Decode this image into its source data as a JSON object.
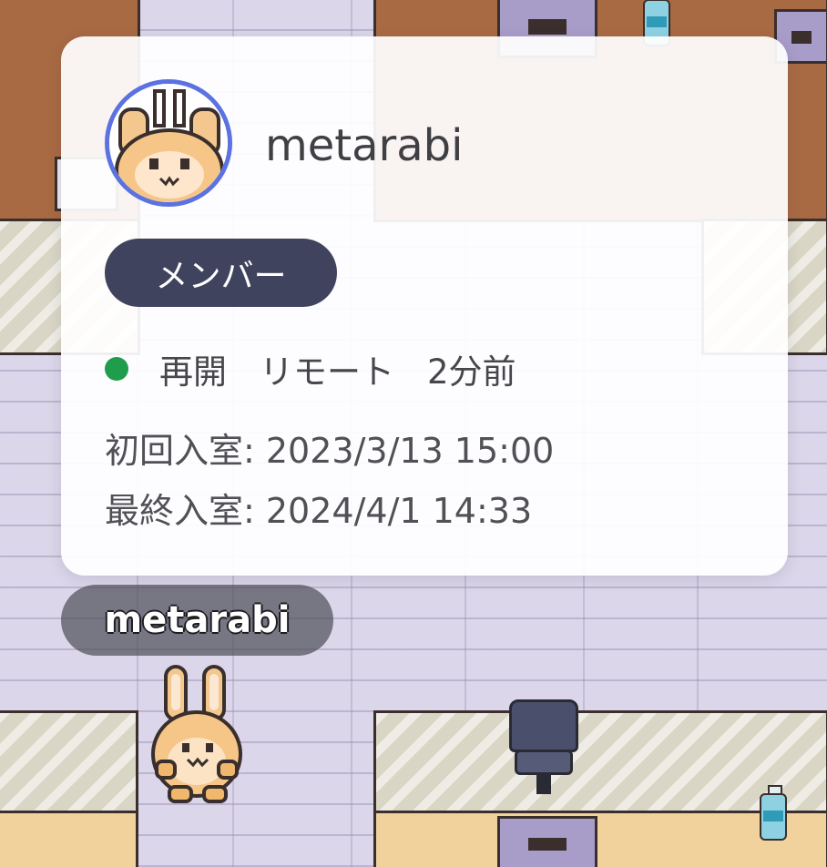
{
  "profile_card": {
    "username": "metarabi",
    "role_badge": "メンバー",
    "status": {
      "indicator_color": "#1f9d4c",
      "activity": "再開",
      "location": "リモート",
      "elapsed": "2分前"
    },
    "first_entry_label": "初回入室: 2023/3/13 15:00",
    "last_entry_label": "最終入室: 2024/4/1 14:33",
    "avatar_icon": "bunny-avatar-icon",
    "avatar_ring_color": "#5b72e0"
  },
  "player": {
    "nameplate": "metarabi",
    "sprite_icon": "bunny-sprite-icon"
  },
  "colors": {
    "badge_background": "#40435d",
    "floor": "#dcd6ea"
  }
}
